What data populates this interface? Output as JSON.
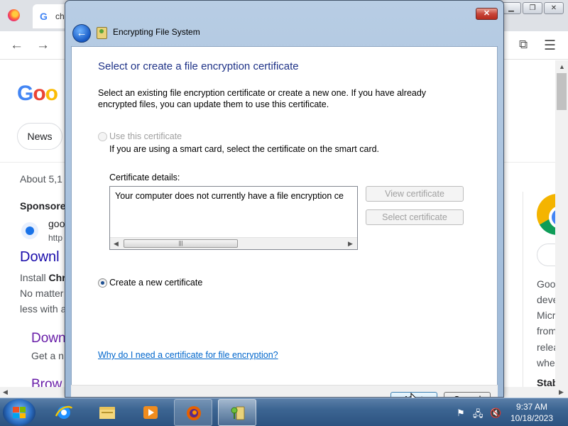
{
  "browser": {
    "tab_title": "ch",
    "google_g": "G",
    "logo_letters": [
      "G",
      "o",
      "o"
    ],
    "news_chip": "News",
    "results_count": "About 5,1",
    "sponsored": "Sponsore",
    "ad_site": "goo",
    "ad_url": "http",
    "ad_headline": "Downl",
    "ad_desc_1_prefix": "Install ",
    "ad_desc_1_bold": "Chr",
    "ad_desc_2": "No matter",
    "ad_desc_3": "less with a",
    "sublink_1_title": "Down",
    "sublink_1_desc": "Get a n",
    "sublink_2_title": "Brow",
    "right_panel": [
      "Goo",
      "deve",
      "Micr",
      "from",
      "relea",
      "wher"
    ],
    "right_panel_bold": "Stab"
  },
  "dialog": {
    "title": "Encrypting File System",
    "close_label": "✕",
    "heading": "Select or create a file encryption certificate",
    "intro": "Select an existing file encryption certificate or create a new one. If you have already encrypted files, you can update them to use this certificate.",
    "option_use": "Use this certificate",
    "option_use_hint": "If you are using a smart card, select the certificate on the smart card.",
    "details_label": "Certificate details:",
    "details_text": "Your computer does not currently have a file encryption ce",
    "view_cert_button": "View certificate",
    "select_cert_button": "Select certificate",
    "option_create": "Create a new certificate",
    "help_link": "Why do I need a certificate for file encryption?",
    "next_button": "Next",
    "cancel_button": "Cancel",
    "selected_option": "create"
  },
  "taskbar": {
    "time": "9:37 AM",
    "date": "10/18/2023",
    "apps": [
      "start-button",
      "internet-explorer",
      "windows-explorer",
      "media-player",
      "firefox",
      "encrypting-file-system"
    ]
  },
  "colors": {
    "dialog_heading": "#1e3287",
    "link": "#0066cc",
    "taskbar": "#2c5280"
  }
}
